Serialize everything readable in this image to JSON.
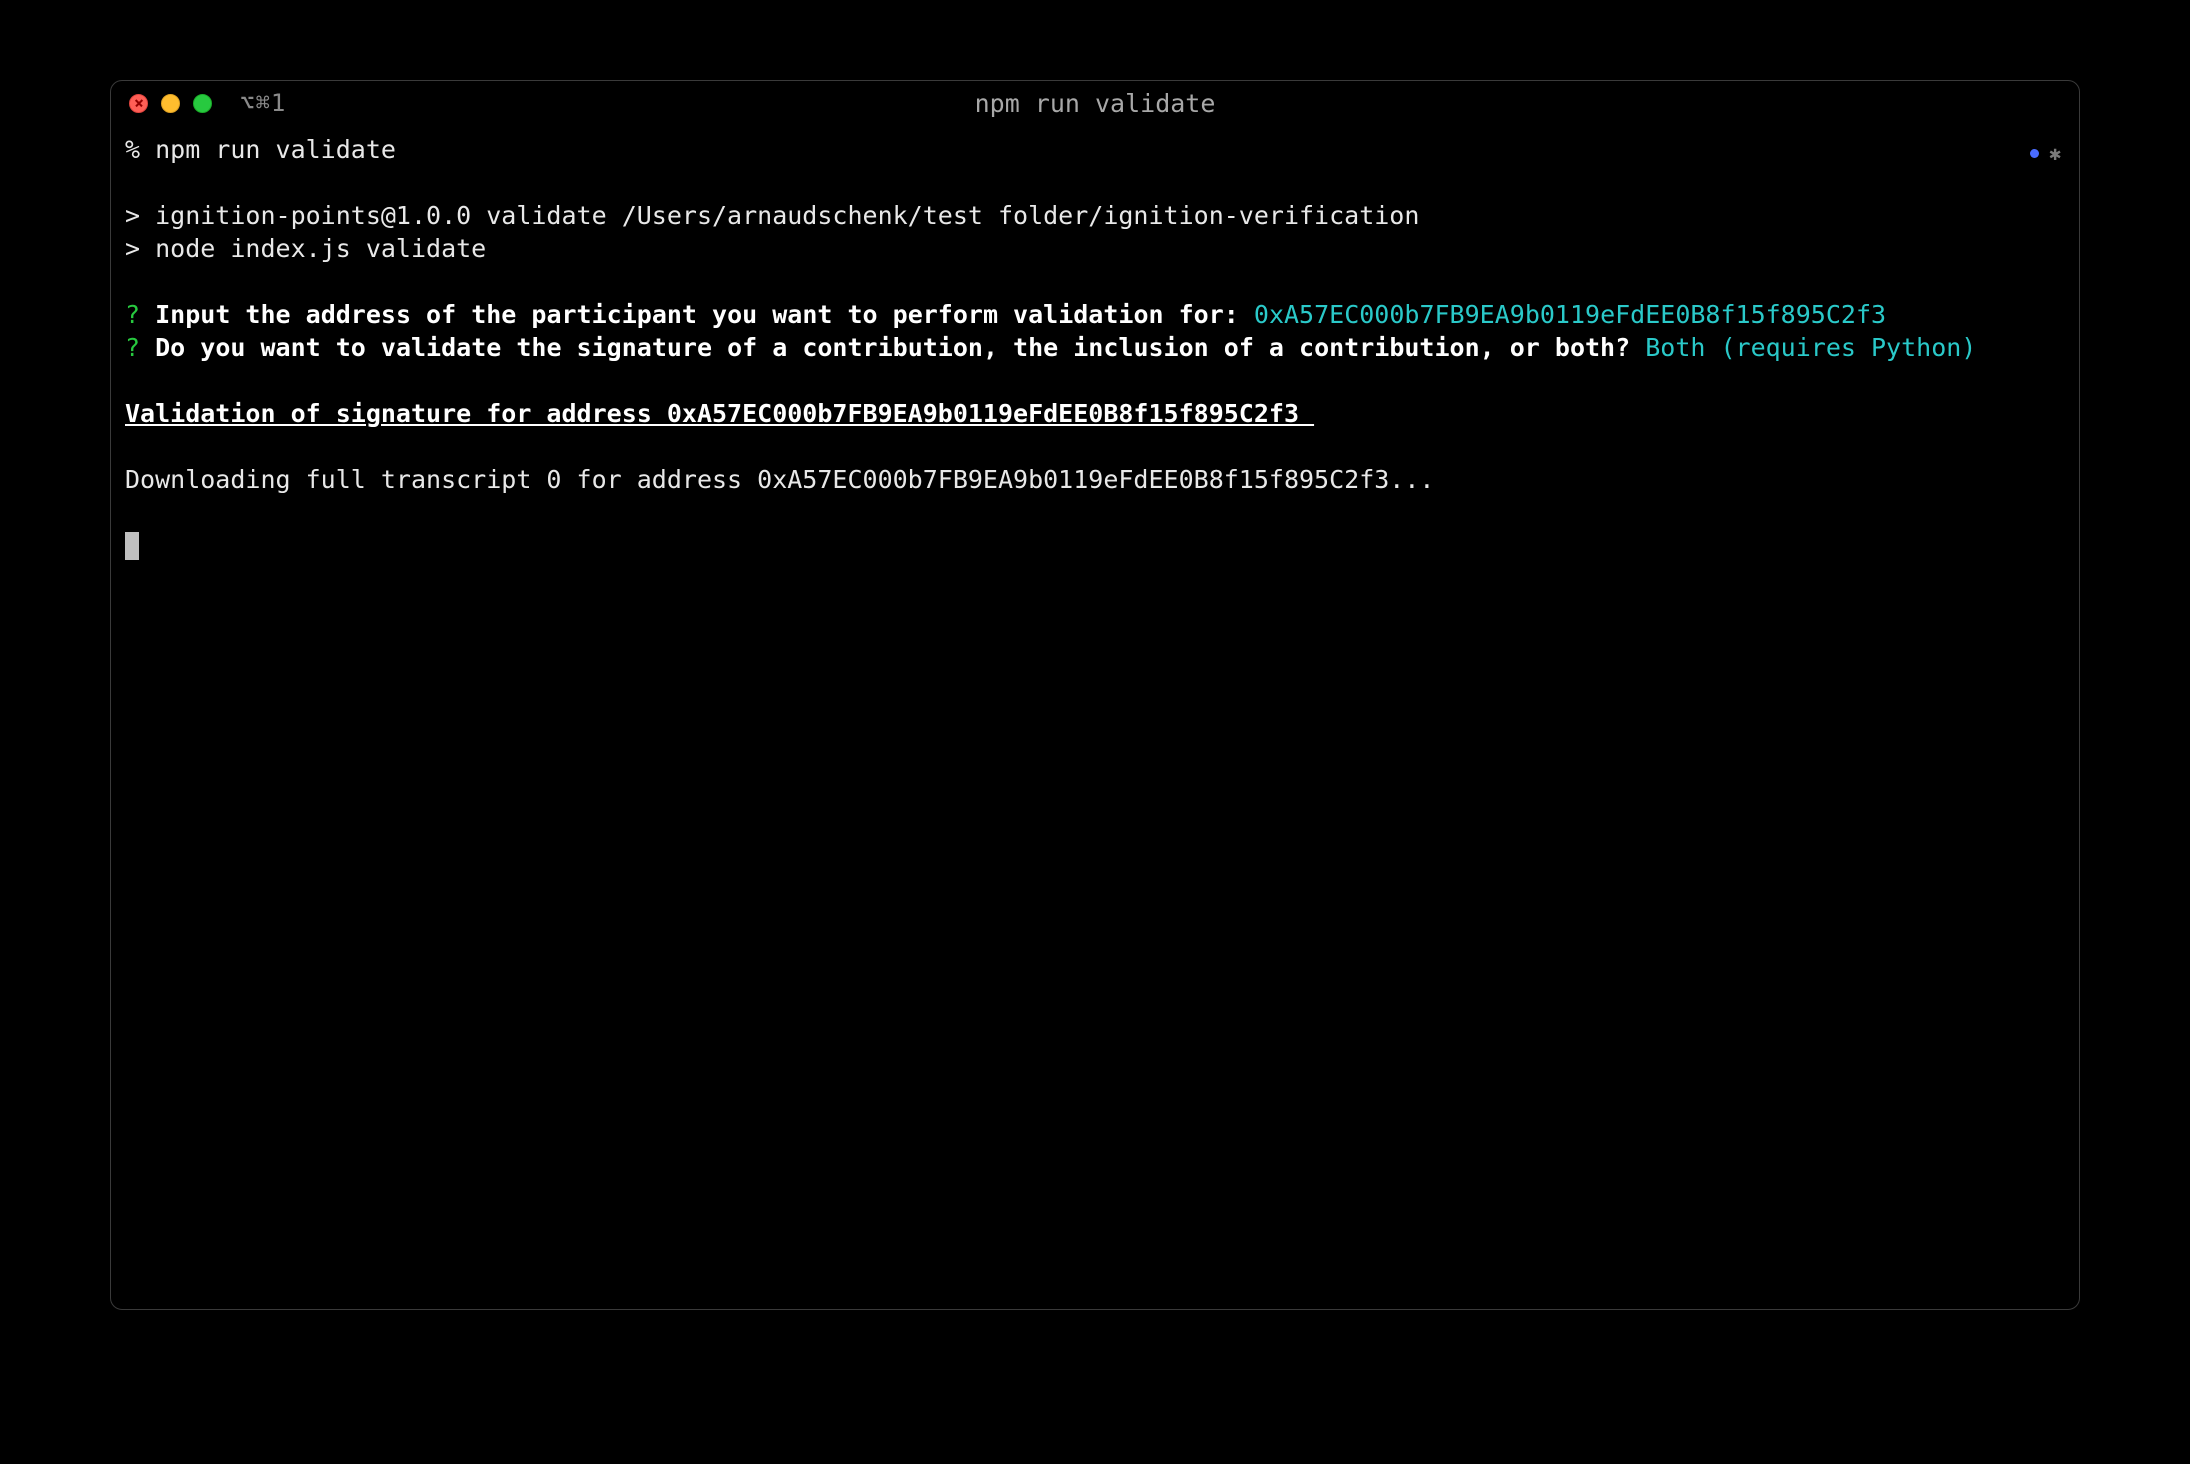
{
  "window": {
    "tab_indicator": "⌥⌘1",
    "title": "npm run validate"
  },
  "lines": {
    "prompt_line": "% npm run validate",
    "script_line_1": "> ignition-points@1.0.0 validate /Users/arnaudschenk/test folder/ignition-verification",
    "script_line_2": "> node index.js validate",
    "q1_marker": "?",
    "q1_prompt": "Input the address of the participant you want to perform validation for:",
    "q1_answer": "0xA57EC000b7FB9EA9b0119eFdEE0B8f15f895C2f3",
    "q2_marker": "?",
    "q2_prompt": "Do you want to validate the signature of a contribution, the inclusion of a contribution, or both?",
    "q2_answer": "Both (requires Python)",
    "heading": "Validation of signature for address 0xA57EC000b7FB9EA9b0119eFdEE0B8f15f895C2f3 ",
    "downloading": "Downloading full transcript 0 for address 0xA57EC000b7FB9EA9b0119eFdEE0B8f15f895C2f3..."
  },
  "status": {
    "star": "✱"
  }
}
